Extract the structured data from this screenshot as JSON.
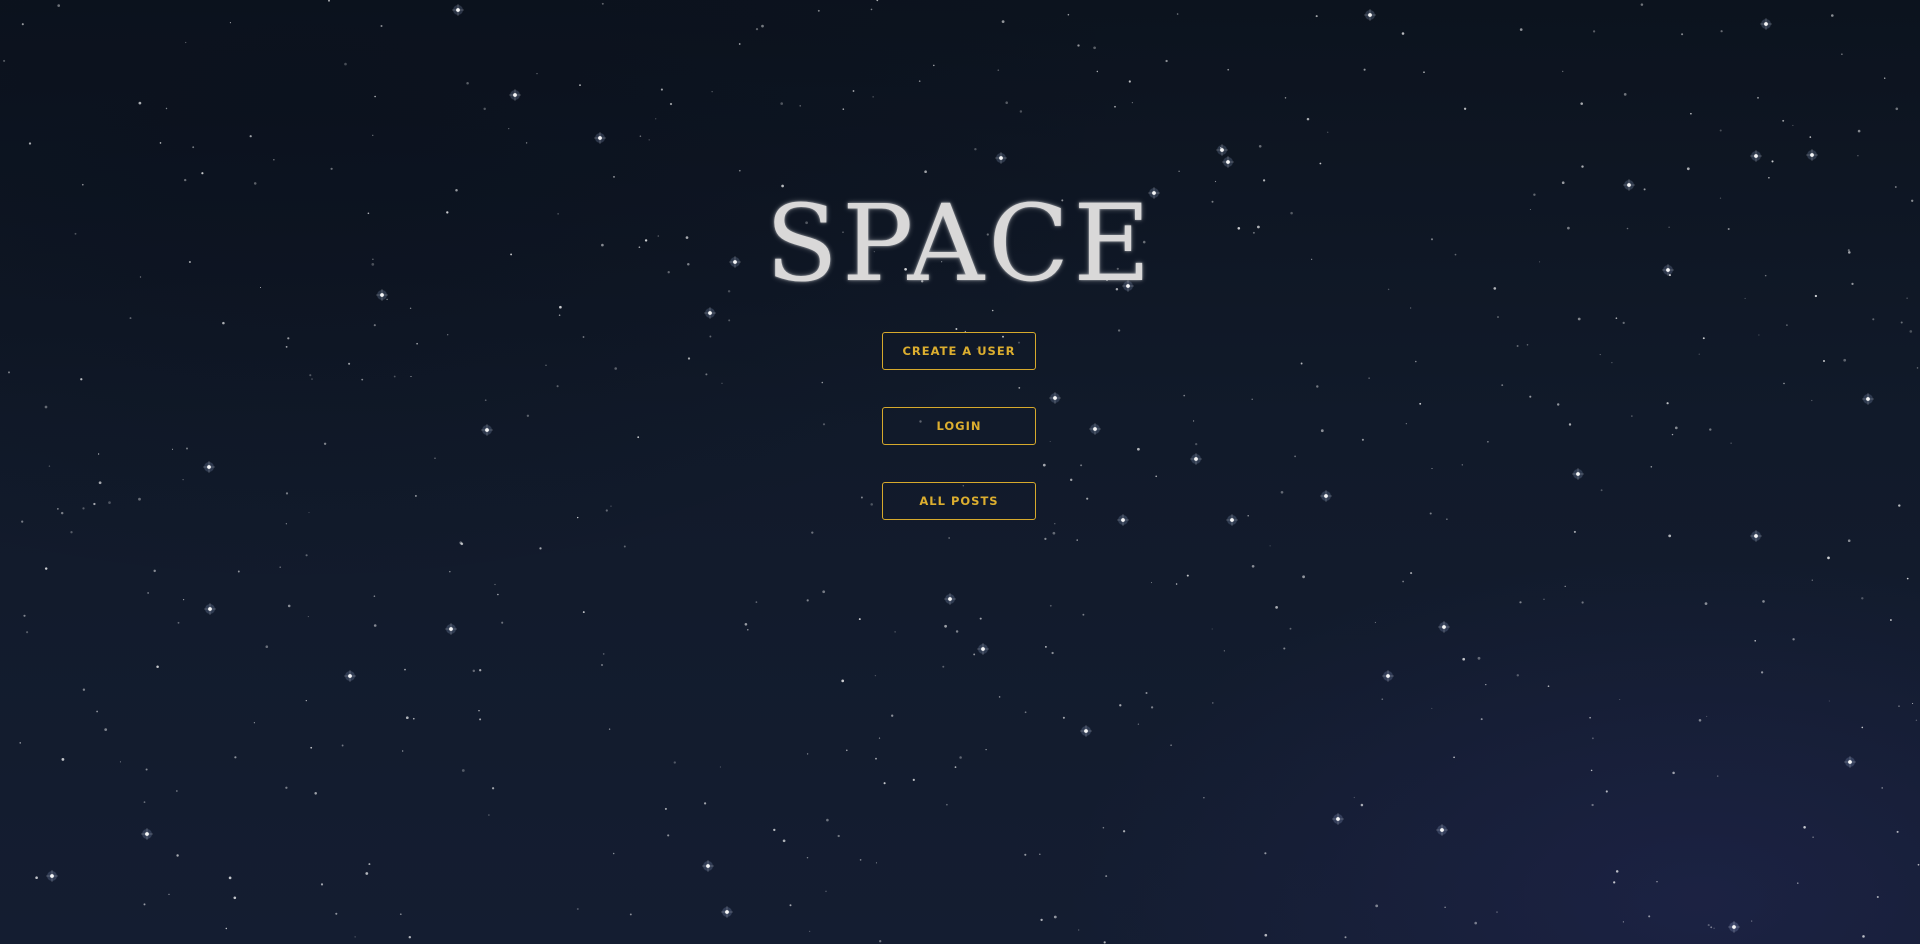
{
  "app": {
    "title": "SPACE"
  },
  "nav": {
    "create_user_label": "CREATE A USER",
    "login_label": "LOGIN",
    "all_posts_label": "ALL POSTS"
  },
  "theme": {
    "accent_color": "#d6a92c",
    "title_color": "#d9d8d8",
    "background_color": "#111a2a"
  }
}
